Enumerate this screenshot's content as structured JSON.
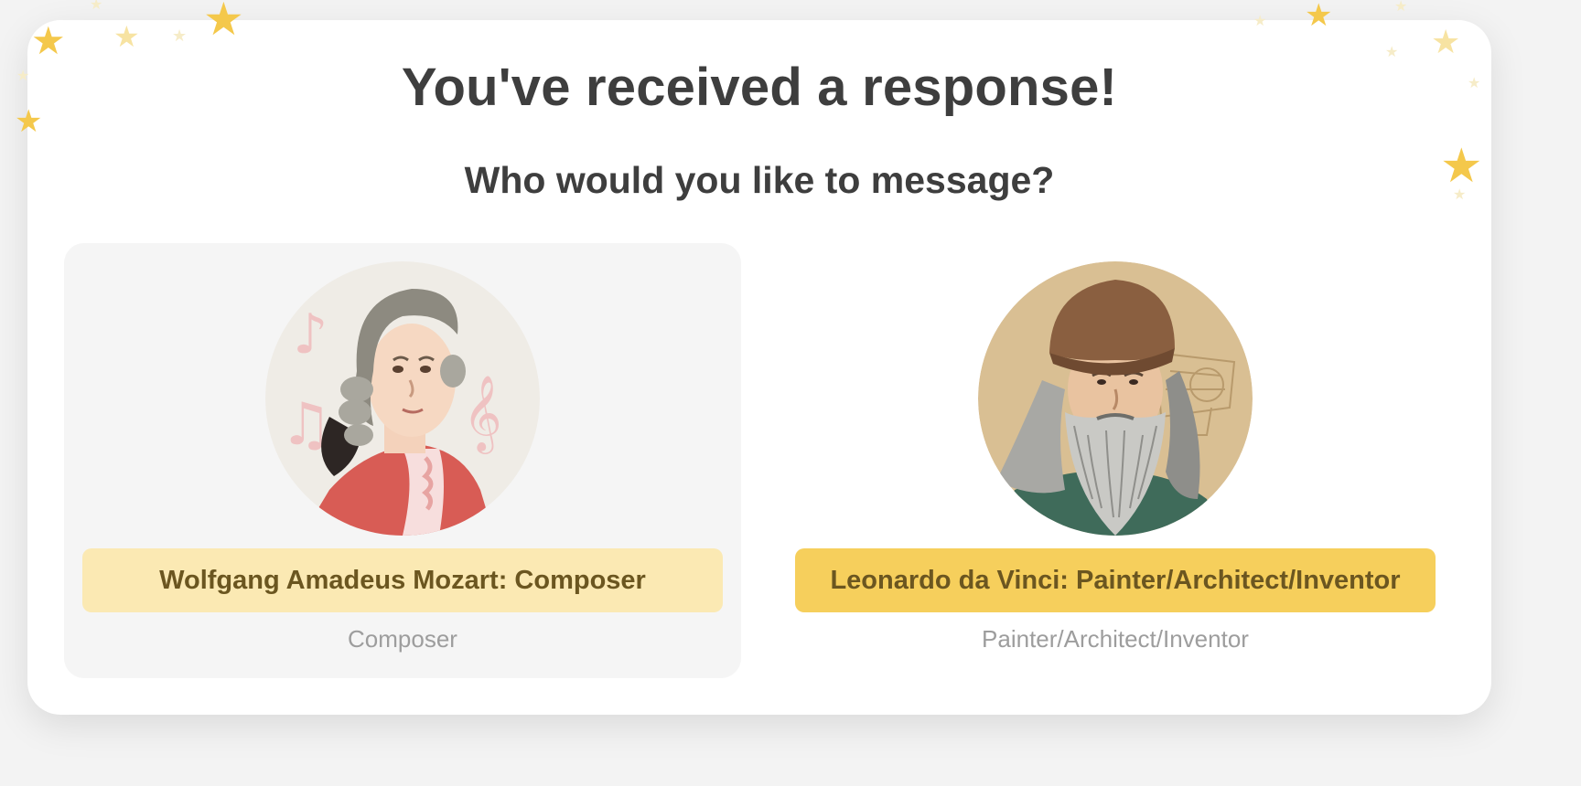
{
  "dialog": {
    "title": "You've received a response!",
    "prompt": "Who would you like to message?"
  },
  "options": [
    {
      "button_label": "Wolfgang Amadeus Mozart: Composer",
      "role": "Composer",
      "selected": true,
      "portrait": "mozart-portrait"
    },
    {
      "button_label": "Leonardo da Vinci: Painter/Architect/Inventor",
      "role": "Painter/Architect/Inventor",
      "selected": false,
      "portrait": "leonardo-portrait"
    }
  ],
  "colors": {
    "background": "#f3f3f3",
    "card": "#ffffff",
    "selected_option_bg": "#f5f5f5",
    "button_light": "#fbe9b3",
    "button_strong": "#f6cf5c",
    "button_text": "#6b5620",
    "title_text": "#3e3e3e",
    "role_text": "#9d9d9d",
    "star": "#f4c84b"
  },
  "icons": [
    "star-icon"
  ]
}
